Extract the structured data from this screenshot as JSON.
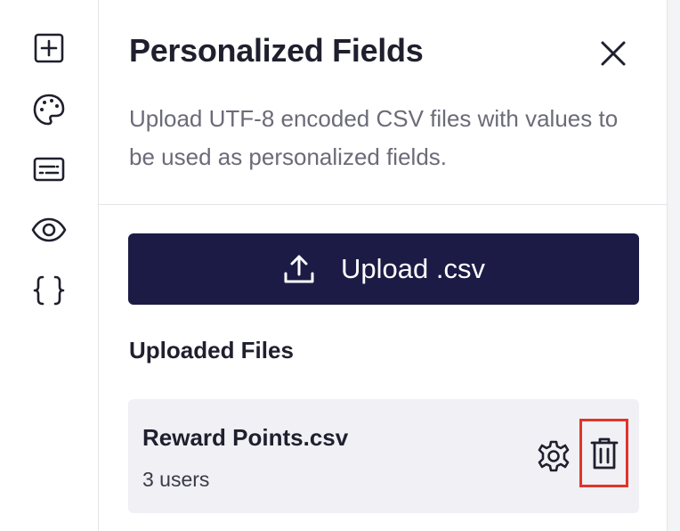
{
  "sidebar": {
    "items": [
      {
        "name": "add",
        "icon": "plus-square-icon"
      },
      {
        "name": "theme",
        "icon": "palette-icon"
      },
      {
        "name": "text",
        "icon": "text-box-icon"
      },
      {
        "name": "preview",
        "icon": "eye-icon"
      },
      {
        "name": "code",
        "icon": "curly-braces-icon"
      }
    ]
  },
  "panel": {
    "title": "Personalized Fields",
    "close_icon": "close-icon",
    "description": "Upload UTF-8 encoded CSV files with values to be used as personalized fields.",
    "upload_button": {
      "label": "Upload .csv",
      "icon": "upload-icon"
    },
    "uploaded_files_title": "Uploaded Files",
    "files": [
      {
        "name": "Reward Points.csv",
        "meta": "3 users",
        "settings_icon": "gear-icon",
        "delete_icon": "trash-icon"
      }
    ]
  },
  "colors": {
    "primary_button": "#1b1b45",
    "file_card_bg": "#f0f0f5",
    "highlight_border": "#e0342b",
    "text_muted": "#6b6b78"
  }
}
